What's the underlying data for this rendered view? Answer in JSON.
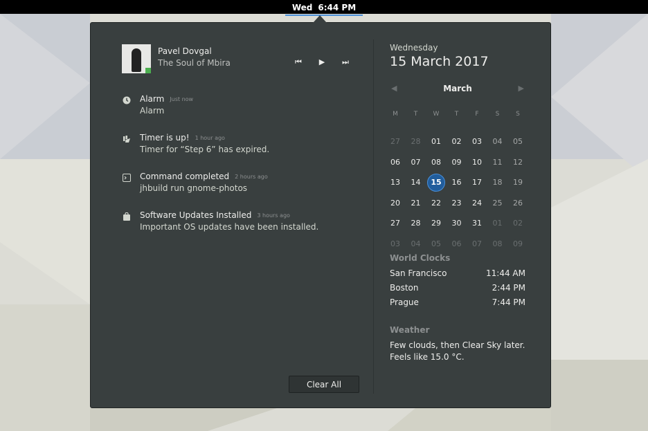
{
  "topbar": {
    "day": "Wed",
    "time": "6:44 PM"
  },
  "media": {
    "artist": "Pavel Dovgal",
    "title": "The Soul of Mbira",
    "controls": {
      "prev": "⏮",
      "play": "▶",
      "next": "⏭"
    }
  },
  "notifications": [
    {
      "icon": "alarm-clock-icon",
      "title": "Alarm",
      "time": "Just now",
      "body": "Alarm"
    },
    {
      "icon": "timer-icon",
      "title": "Timer is up!",
      "time": "1 hour ago",
      "body": "Timer for “Step 6” has expired."
    },
    {
      "icon": "terminal-icon",
      "title": "Command completed",
      "time": "2 hours ago",
      "body": "jhbuild run gnome-photos"
    },
    {
      "icon": "shopping-bag-icon",
      "title": "Software Updates Installed",
      "time": "3 hours ago",
      "body": "Important OS updates have been installed."
    }
  ],
  "clear_all_label": "Clear All",
  "date": {
    "day_name": "Wednesday",
    "full_date": "15 March 2017"
  },
  "calendar": {
    "month": "March",
    "prev_label": "◀",
    "next_label": "▶",
    "weekdays": [
      "M",
      "T",
      "W",
      "T",
      "F",
      "S",
      "S"
    ],
    "weeks": [
      [
        "27",
        "28",
        "01",
        "02",
        "03",
        "04",
        "05"
      ],
      [
        "06",
        "07",
        "08",
        "09",
        "10",
        "11",
        "12"
      ],
      [
        "13",
        "14",
        "15",
        "16",
        "17",
        "18",
        "19"
      ],
      [
        "20",
        "21",
        "22",
        "23",
        "24",
        "25",
        "26"
      ],
      [
        "27",
        "28",
        "29",
        "30",
        "31",
        "01",
        "02"
      ],
      [
        "03",
        "04",
        "05",
        "06",
        "07",
        "08",
        "09"
      ]
    ],
    "today": "15"
  },
  "world_clocks": {
    "title": "World Clocks",
    "items": [
      {
        "city": "San Francisco",
        "time": "11:44 AM"
      },
      {
        "city": "Boston",
        "time": "2:44 PM"
      },
      {
        "city": "Prague",
        "time": "7:44 PM"
      }
    ]
  },
  "weather": {
    "title": "Weather",
    "line1": "Few clouds, then Clear Sky later.",
    "line2": "Feels like 15.0 °C."
  },
  "colors": {
    "accent": "#4a90d9",
    "today": "#215d9c",
    "popup_bg": "#393f3f",
    "topbar": "#000000"
  }
}
